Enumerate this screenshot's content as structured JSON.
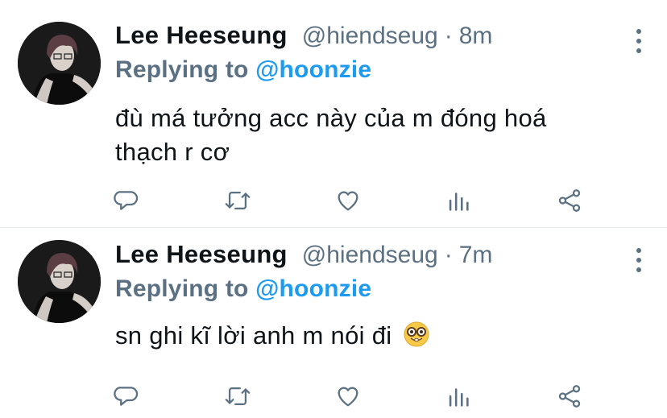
{
  "tweets": [
    {
      "display_name": "Lee Heeseung",
      "handle": "@hiendseug",
      "separator": "·",
      "time": "8m",
      "replying_prefix": "Replying to",
      "replying_to": "@hoonzie",
      "text_lines": [
        "đù má tưởng acc này của m đóng hoá",
        "thạch r cơ"
      ]
    },
    {
      "display_name": "Lee Heeseung",
      "handle": "@hiendseug",
      "separator": "·",
      "time": "7m",
      "replying_prefix": "Replying to",
      "replying_to": "@hoonzie",
      "text_lines": [
        "sn ghi kĩ lời anh m nói đi"
      ],
      "emoji": "nerd-face-emoji"
    }
  ],
  "icons": {
    "reply": "comment-icon",
    "retweet": "retweet-icon",
    "like": "heart-icon",
    "analytics": "analytics-icon",
    "share": "share-icon",
    "more": "more-vertical-icon"
  },
  "colors": {
    "muted": "#5b7083",
    "accent": "#1d9bf0",
    "text": "#0f1419",
    "divider": "#e6ecf0"
  }
}
